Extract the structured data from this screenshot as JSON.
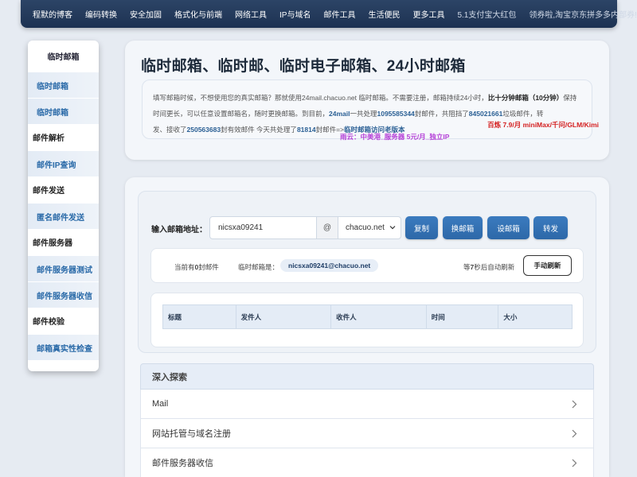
{
  "nav": {
    "items": [
      "程默的博客",
      "编码转换",
      "安全加固",
      "格式化与前端",
      "网络工具",
      "IP与域名",
      "邮件工具",
      "生活便民",
      "更多工具"
    ],
    "promo1": "5.1支付宝大红包",
    "promo2": "领券啦,淘宝京东拼多多内部券!"
  },
  "sidebar": {
    "title": "临时邮箱",
    "rows": [
      {
        "label": "临时邮箱",
        "type": "link"
      },
      {
        "label": "临时邮箱",
        "type": "link"
      },
      {
        "label": "邮件解析",
        "type": "head"
      },
      {
        "label": "邮件IP查询",
        "type": "link"
      },
      {
        "label": "邮件发送",
        "type": "head"
      },
      {
        "label": "匿名邮件发送",
        "type": "link"
      },
      {
        "label": "邮件服务器",
        "type": "head"
      },
      {
        "label": "邮件服务器测试",
        "type": "link"
      },
      {
        "label": "邮件服务器收信",
        "type": "link"
      },
      {
        "label": "邮件校验",
        "type": "head"
      },
      {
        "label": "邮箱真实性检查",
        "type": "link"
      }
    ]
  },
  "header": {
    "title": "临时邮箱、临时邮、临时电子邮箱、24小时邮箱",
    "intro": {
      "p1": "填写邮箱时候，不想使用您的真实邮箱？那就使用24mail.chacuo.net 临时邮箱。不需要注册，邮箱持续24小时，",
      "p1_strong": "比十分钟邮箱（10分钟）",
      "p1_tail": "保",
      "p2": "持时间更长，可以任意设置邮箱名，随时更换邮箱。到目前，",
      "p2_strong": "24mail",
      "p2_mid": "一共处理",
      "p2_num": "1095585344",
      "p2_mid2": "封邮件，共阻挡了",
      "p2_num2": "845021661",
      "p2_tail": "垃圾邮件，转",
      "p3": "发、接收了",
      "p3_num": "250563683",
      "p3_mid": "封有效邮件 今天共处理了",
      "p3_num2": "81814",
      "p3_mid2": "封邮件=>",
      "p3_link": "临时邮箱访问老版本"
    },
    "promo_red": "百炼 7.9/月 miniMax/千问/GLM/Kimi",
    "promo_purple": "雨云：中美港_服务器 5元/月_独立IP"
  },
  "mailbox": {
    "label": "输入邮箱地址：",
    "input_value": "nicsxa09241",
    "at": "@",
    "domain": "chacuo.net",
    "buttons": [
      "复制",
      "换邮箱",
      "设邮箱",
      "转发"
    ],
    "count_prefix": "当前有",
    "count": "0",
    "count_suffix": "封邮件",
    "current_label": "临时邮箱是：",
    "current_address": "nicsxa09241@chacuo.net",
    "auto_prefix": "等",
    "auto_seconds": "7",
    "auto_suffix": "秒后自动刷新",
    "refresh": "手动刷新",
    "columns": [
      "标题",
      "发件人",
      "收件人",
      "时间",
      "大小"
    ]
  },
  "explore": {
    "title": "深入探索",
    "items": [
      "Mail",
      "网站托管与域名注册",
      "邮件服务器收信"
    ]
  }
}
